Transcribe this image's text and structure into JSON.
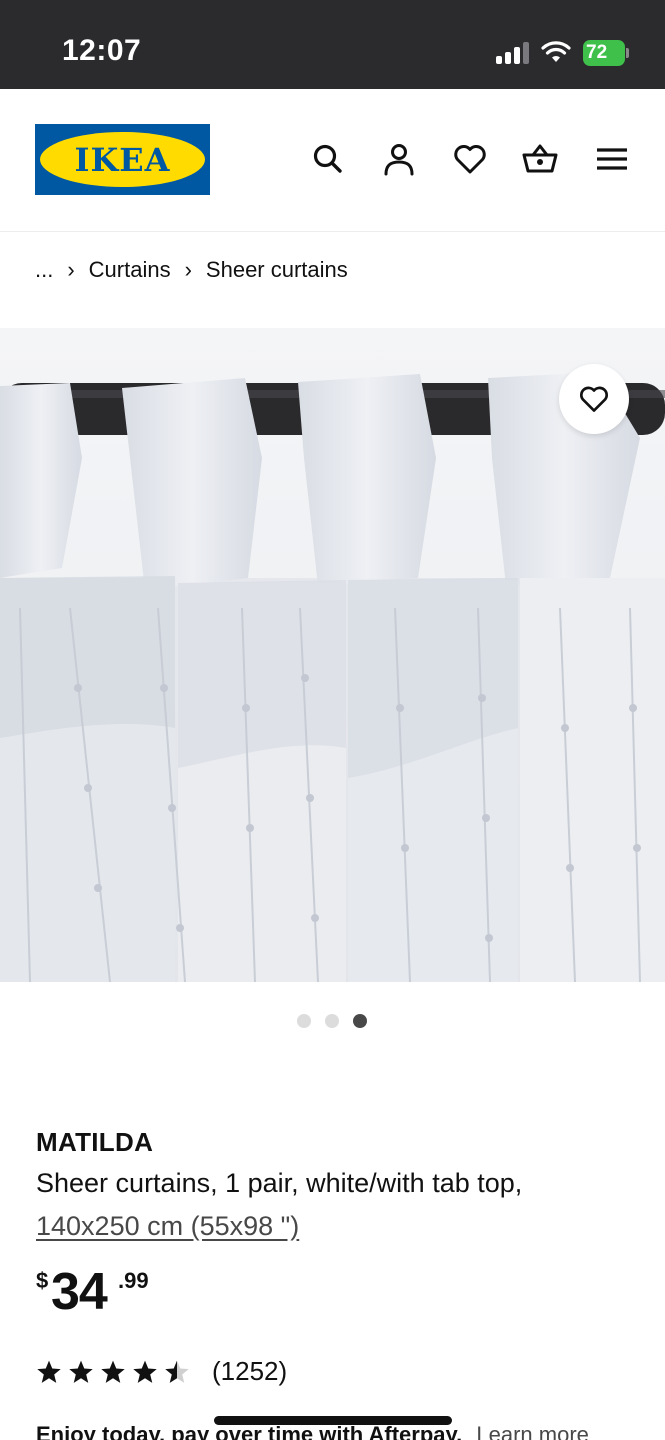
{
  "status_bar": {
    "time": "12:07",
    "battery": "72"
  },
  "header": {
    "logo_text": "IKEA",
    "icons": [
      "search-icon",
      "account-icon",
      "favorites-icon",
      "cart-icon",
      "menu-icon"
    ]
  },
  "breadcrumb": {
    "ellipsis": "...",
    "items": [
      "Curtains",
      "Sheer curtains"
    ]
  },
  "gallery": {
    "total_images": 3,
    "active_index": 3
  },
  "product": {
    "name": "MATILDA",
    "description": "Sheer curtains, 1 pair, white/with tab top,",
    "size": "140x250 cm (55x98 \")",
    "price": {
      "currency": "$",
      "integer": "34",
      "decimal": ".99"
    },
    "rating": {
      "stars": 4.5,
      "count": "(1252)"
    }
  },
  "afterpay": {
    "text": "Enjoy today, pay over time with Afterpay.",
    "link": "Learn more"
  },
  "colors": {
    "ikea_blue": "#0058a3",
    "ikea_yellow": "#ffdb00",
    "status_bar_bg": "#2b2b2e"
  }
}
